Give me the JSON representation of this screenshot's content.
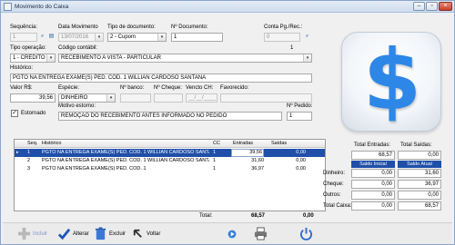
{
  "window": {
    "title": "Movimento do Caixa"
  },
  "form": {
    "sequencia": {
      "label": "Sequência:",
      "value": "1"
    },
    "data_movimento": {
      "label": "Data Movimento",
      "value": "13/07/2016"
    },
    "tipo_documento": {
      "label": "Tipo de documento:",
      "value": "2 - Cupom"
    },
    "n_documento": {
      "label": "Nº Documento:",
      "value": "1"
    },
    "conta_pg_rec": {
      "label": "Conta Pg./Rec.:",
      "value": "0"
    },
    "tipo_operacao": {
      "label": "Tipo operação:",
      "value": "1 - CRÉDITO"
    },
    "codigo_contabil": {
      "label": "Código contábil:",
      "number": "1",
      "value": "RECEBIMENTO A VISTA - PARTICULAR"
    },
    "historico": {
      "label": "Histórico:",
      "value": "PGTO NA ENTREGA EXAME(S) PED. CÓD. 1 WILLIAN CARDOSO SANTANA"
    },
    "valor": {
      "label": "Valor R$:",
      "value": "39,56"
    },
    "especie": {
      "label": "Espécie:",
      "value": "DINHEIRO"
    },
    "n_banco": {
      "label": "Nº banco:",
      "value": ""
    },
    "n_cheque": {
      "label": "Nº Cheque:",
      "value": ""
    },
    "vencto_ch": {
      "label": "Vencto CH:",
      "value": "__/__/____"
    },
    "favorecido": {
      "label": "Favorecido:",
      "value": ""
    },
    "estornado": {
      "label": "Estornado",
      "checked": true
    },
    "motivo_estorno": {
      "label": "Motivo estorno:",
      "value": "REMOÇÃO DO RECEBIMENTO ANTES INFORMADO NO PEDIDO"
    },
    "n_pedido": {
      "label": "Nº Pedido:",
      "value": "1"
    }
  },
  "grid": {
    "headers": {
      "seq": "Seq.",
      "historico": "Histórico",
      "cc": "CC",
      "entradas": "Entradas",
      "saidas": "Saídas"
    },
    "rows": [
      {
        "seq": "1",
        "historico": "PGTO NA ENTREGA EXAME(S) PED. CÓD. 1 WILLIAN CARDOSO SANTANA",
        "cc": "1",
        "entradas": "39,56",
        "saidas": "0,00"
      },
      {
        "seq": "2",
        "historico": "PGTO NA ENTREGA EXAME(S) PED. CÓD. 1 WILLIAN CARDOSO SANTANA",
        "cc": "1",
        "entradas": "31,60",
        "saidas": "0,00"
      },
      {
        "seq": "3",
        "historico": "PGTO NA ENTREGA EXAME(S) PED. CÓD. 1",
        "cc": "1",
        "entradas": "36,97",
        "saidas": "0,00"
      }
    ],
    "selected_row": 0
  },
  "totals": {
    "label": "Total:",
    "entradas": "68,57",
    "saidas": "0,00"
  },
  "summary": {
    "total_entradas": {
      "label": "Total Entradas:",
      "value": "68,57"
    },
    "total_saidas": {
      "label": "Total Saídas:",
      "value": "0,00"
    },
    "saldo_inicial_label": "Saldo Inicial",
    "saldo_atual_label": "Saldo Atual",
    "rows": [
      {
        "label": "Dinheiro:",
        "inicial": "0,00",
        "atual": "31,60"
      },
      {
        "label": "Cheque:",
        "inicial": "0,00",
        "atual": "36,97"
      },
      {
        "label": "Outros:",
        "inicial": "0,00",
        "atual": "0,00"
      },
      {
        "label": "Total Caixa:",
        "inicial": "0,00",
        "atual": "68,57"
      }
    ]
  },
  "toolbar": {
    "incluir": "Incluir",
    "alterar": "Alterar",
    "excluir": "Excluir",
    "voltar": "Voltar"
  },
  "colors": {
    "accent": "#2d87e6",
    "selection": "#1f4fa8",
    "header_col": "#1f4fa8"
  }
}
